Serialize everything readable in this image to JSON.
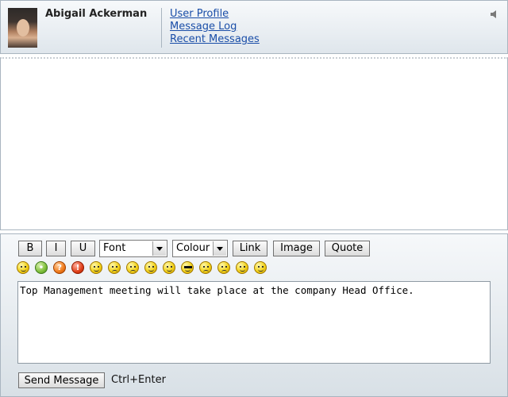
{
  "header": {
    "user_name": "Abigail Ackerman",
    "links": [
      "User Profile",
      "Message Log",
      "Recent Messages"
    ],
    "sound_icon": "speaker-icon"
  },
  "toolbar": {
    "bold_label": "B",
    "italic_label": "I",
    "underline_label": "U",
    "font_select": "Font",
    "colour_select": "Colour",
    "link_label": "Link",
    "image_label": "Image",
    "quote_label": "Quote"
  },
  "emoticons": [
    "grin-icon",
    "lightbulb-icon",
    "question-icon",
    "exclamation-icon",
    "wink-icon",
    "angry-icon",
    "sad-icon",
    "confused-icon",
    "kiss-icon",
    "cool-icon",
    "shocked-icon",
    "worried-icon",
    "smile-icon",
    "neutral-icon"
  ],
  "composer": {
    "message_text": "Top Management meeting will take place at the company Head Office.",
    "send_label": "Send Message",
    "shortcut_hint": "Ctrl+Enter"
  }
}
